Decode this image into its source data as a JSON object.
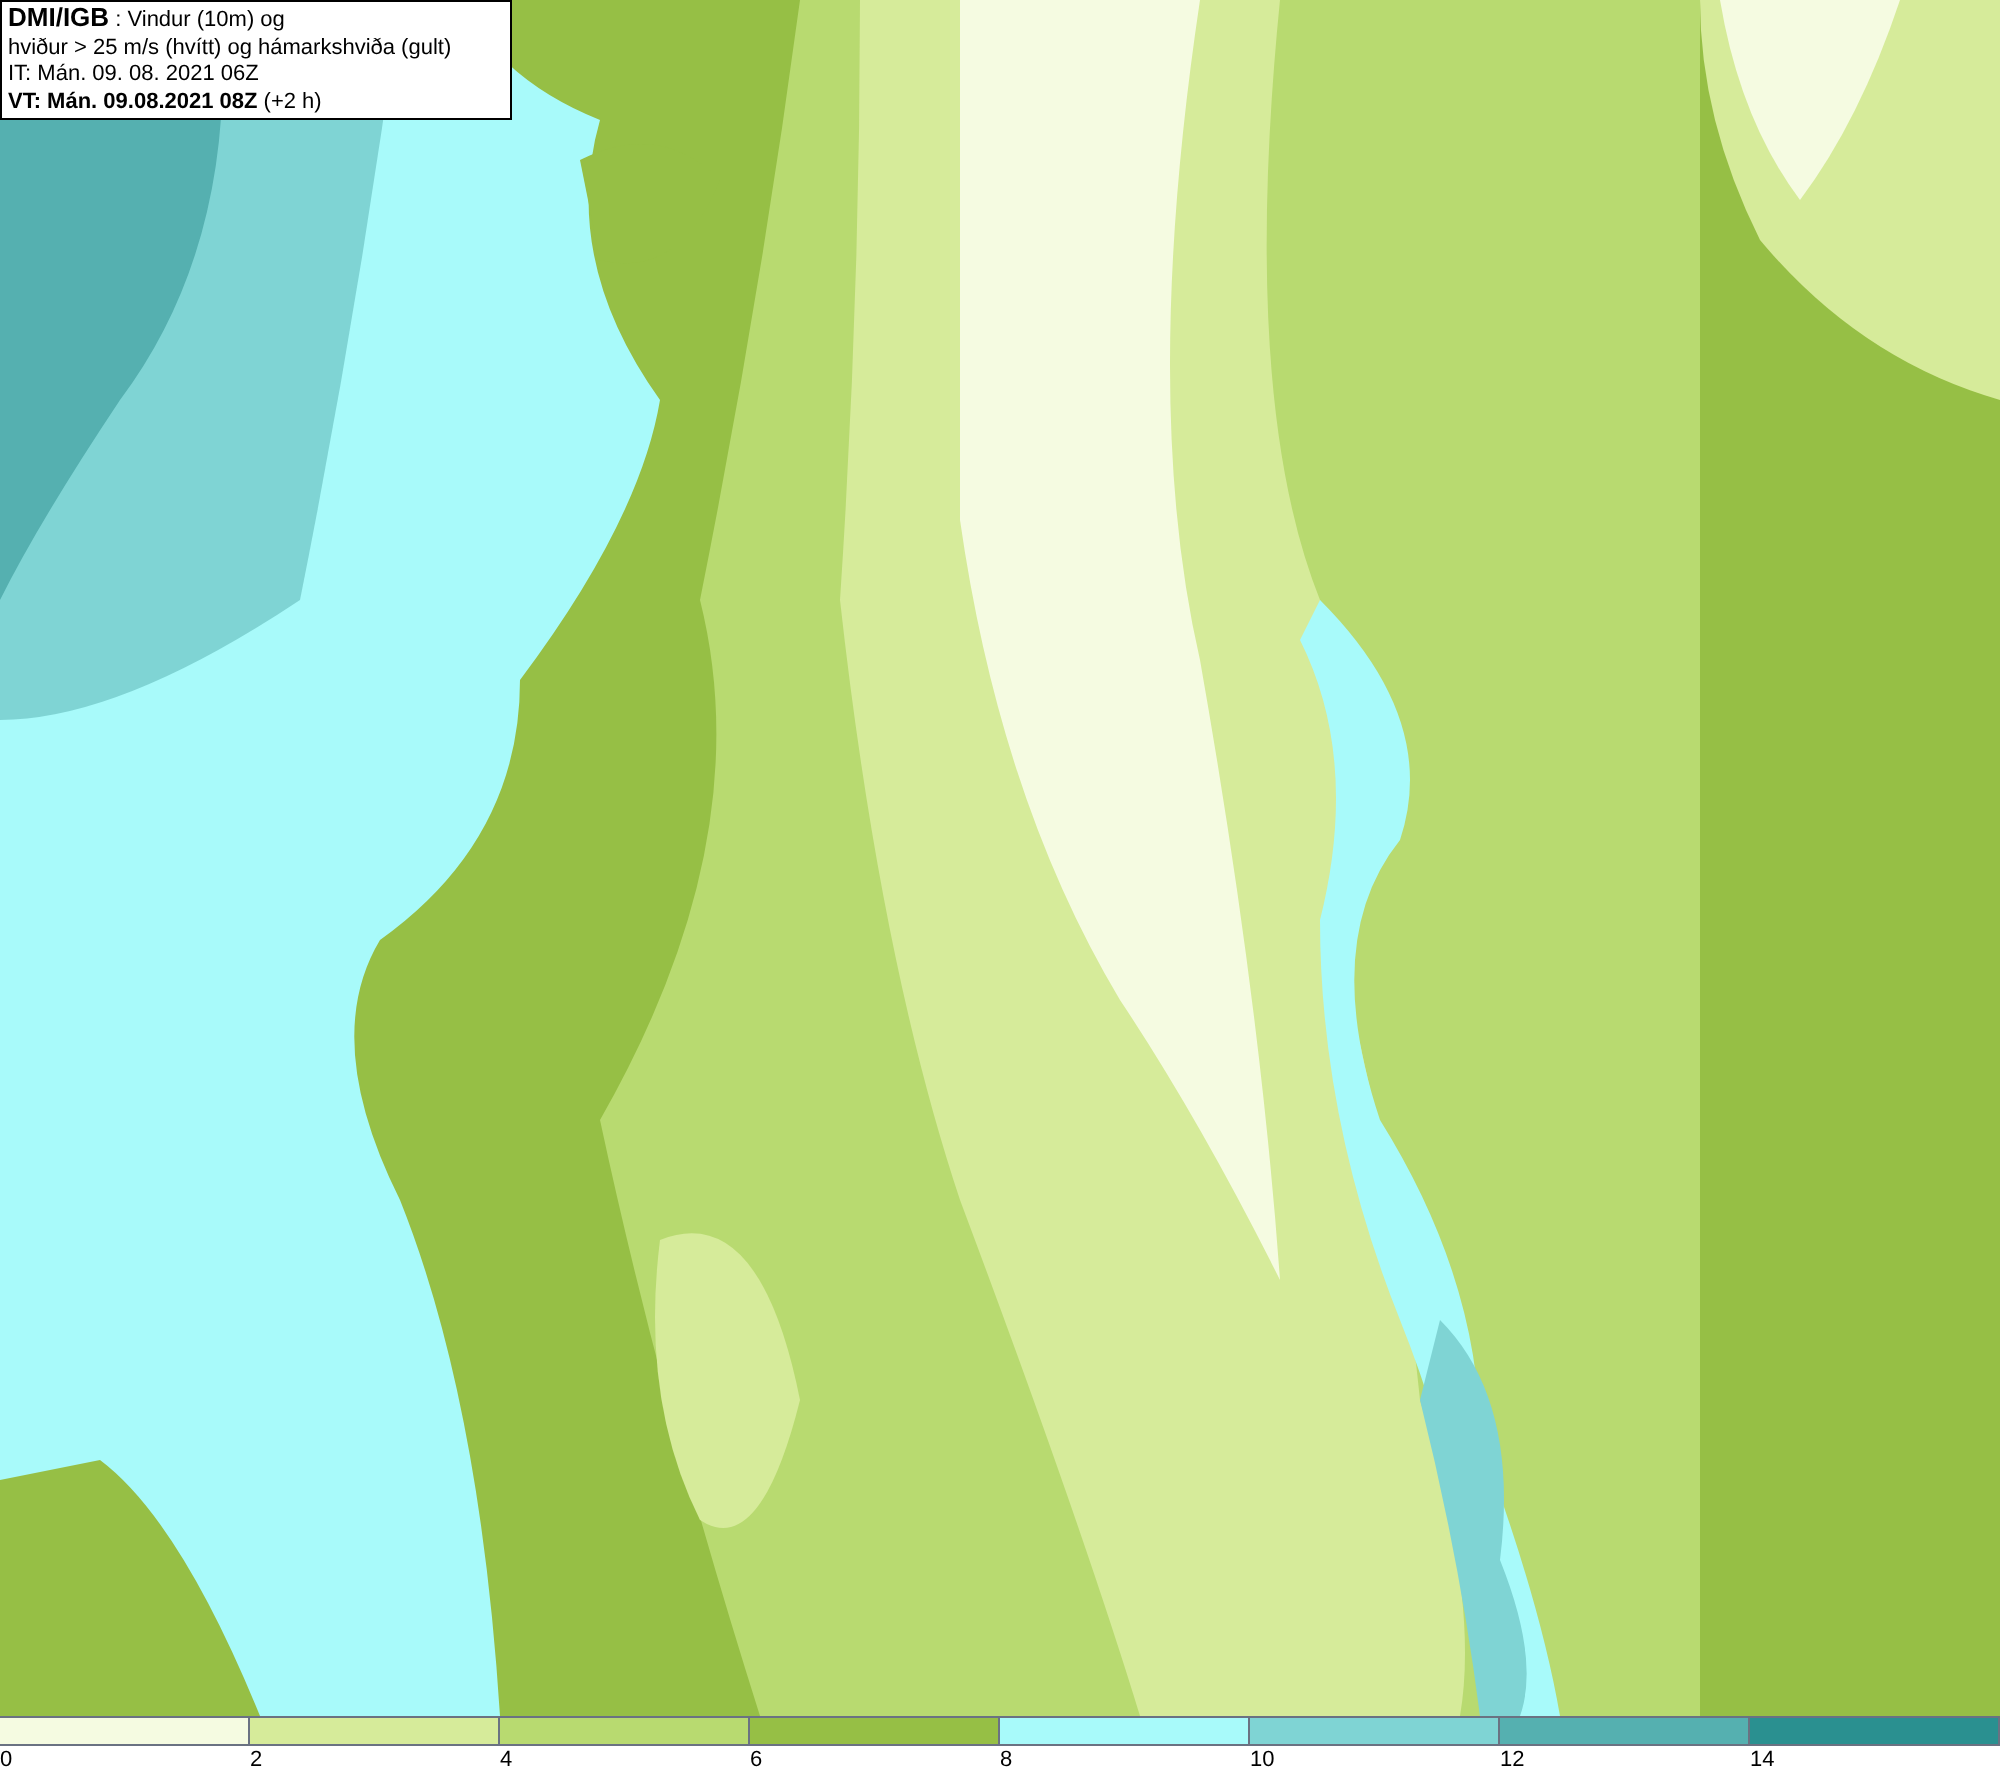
{
  "header": {
    "source": "DMI/IGB",
    "title": " : Vindur (10m) og",
    "subtitle": "hviður > 25 m/s (hvítt) og hámarkshviða (gult)",
    "initial_time": "IT: Mán. 09. 08. 2021 06Z",
    "valid_time": "VT: Mán. 09.08.2021 08Z",
    "offset": " (+2 h)"
  },
  "legend": {
    "bins": [
      {
        "color": "#f5fbe1"
      },
      {
        "color": "#d6eb9a"
      },
      {
        "color": "#b8da70"
      },
      {
        "color": "#96bf45"
      },
      {
        "color": "#a8fafa"
      },
      {
        "color": "#7fd4d4"
      },
      {
        "color": "#55b0b0"
      },
      {
        "color": "#2a9090"
      }
    ],
    "ticks": [
      "0",
      "2",
      "4",
      "6",
      "8",
      "10",
      "12",
      "14"
    ]
  }
}
